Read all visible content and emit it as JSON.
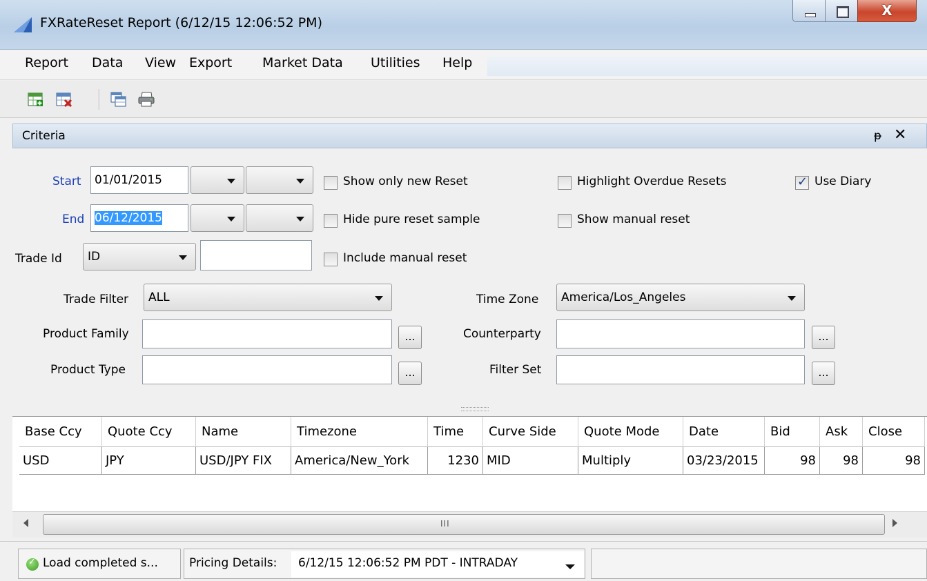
{
  "window": {
    "title": "FXRateReset Report (6/12/15 12:06:52 PM)",
    "close_glyph": "X"
  },
  "menu": [
    "Report",
    "Data",
    "View",
    "Export",
    "Market Data",
    "Utilities",
    "Help"
  ],
  "toolbar": {
    "icons": [
      "new-report-icon",
      "delete-report-icon",
      "copy-report-icon",
      "print-icon"
    ]
  },
  "criteria": {
    "title": "Criteria",
    "pin_glyph": "ᵽ",
    "close_glyph": "✕",
    "start_label": "Start",
    "start_value": "01/01/2015",
    "end_label": "End",
    "end_value": "06/12/2015",
    "trade_id_label": "Trade Id",
    "trade_id_type": "ID",
    "trade_id_value": "",
    "show_only_new_reset": {
      "label": "Show only new Reset",
      "checked": false
    },
    "hide_pure_reset_sample": {
      "label": "Hide pure reset sample",
      "checked": false
    },
    "include_manual_reset": {
      "label": "Include manual reset",
      "checked": false
    },
    "highlight_overdue_resets": {
      "label": "Highlight Overdue Resets",
      "checked": false
    },
    "show_manual_reset": {
      "label": "Show manual reset",
      "checked": false
    },
    "use_diary": {
      "label": "Use Diary",
      "checked": true
    },
    "trade_filter_label": "Trade Filter",
    "trade_filter_value": "ALL",
    "time_zone_label": "Time Zone",
    "time_zone_value": "America/Los_Angeles",
    "product_family_label": "Product Family",
    "product_family_value": "",
    "product_type_label": "Product Type",
    "product_type_value": "",
    "counterparty_label": "Counterparty",
    "counterparty_value": "",
    "filter_set_label": "Filter Set",
    "filter_set_value": "",
    "ellipsis": "..."
  },
  "table": {
    "columns": [
      "Base Ccy",
      "Quote Ccy",
      "Name",
      "Timezone",
      "Time",
      "Curve Side",
      "Quote Mode",
      "Date",
      "Bid",
      "Ask",
      "Close"
    ],
    "rows": [
      [
        "USD",
        "JPY",
        "USD/JPY FIX",
        "America/New_York",
        "1230",
        "MID",
        "Multiply",
        "03/23/2015",
        "98",
        "98",
        "98"
      ]
    ],
    "scroll_grip": "III"
  },
  "status": {
    "load_message": "Load completed s...",
    "pricing_label": "Pricing Details:",
    "pricing_value": "6/12/15 12:06:52 PM PDT - INTRADAY"
  },
  "colors": {
    "selection": "#3399ff",
    "label_blue": "#1a3fb5",
    "header_blue": "#c9d7e7"
  }
}
